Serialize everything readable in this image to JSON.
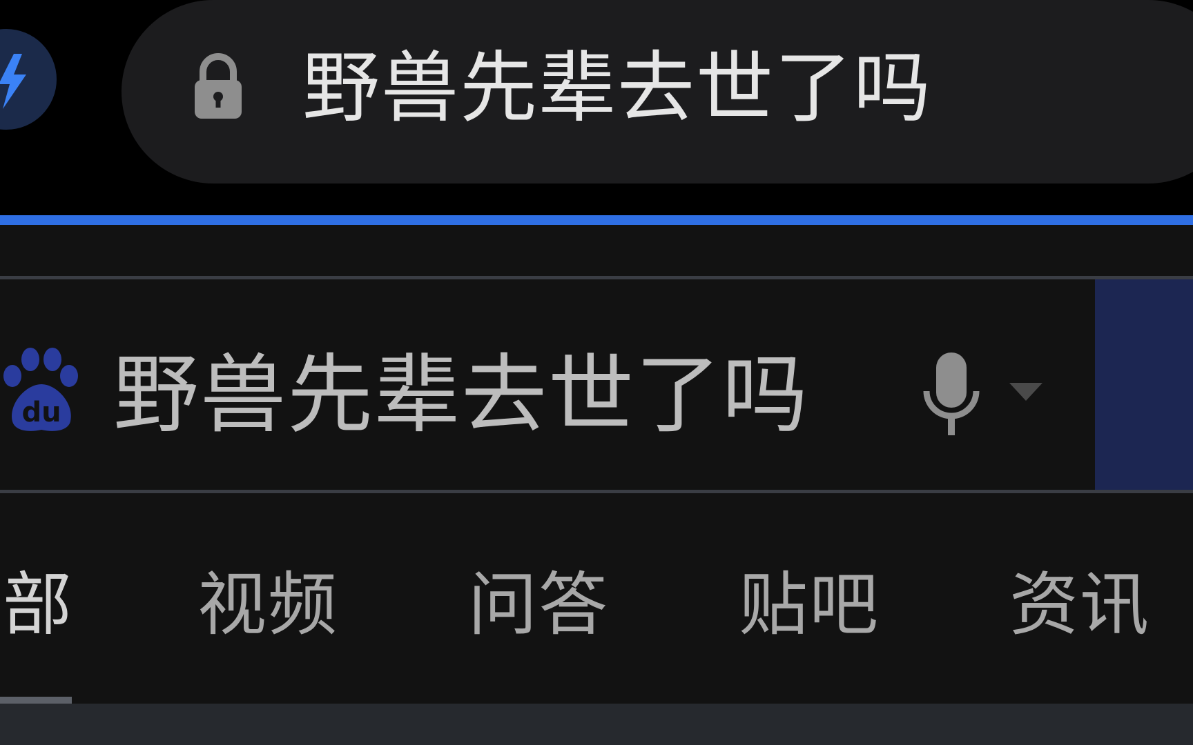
{
  "browser": {
    "url_text": "野兽先辈去世了吗"
  },
  "search": {
    "query": "野兽先辈去世了吗"
  },
  "tabs": [
    {
      "label": "部",
      "active": true
    },
    {
      "label": "视频",
      "active": false
    },
    {
      "label": "问答",
      "active": false
    },
    {
      "label": "贴吧",
      "active": false
    },
    {
      "label": "资讯",
      "active": false
    }
  ],
  "colors": {
    "accent": "#2f6fe4",
    "brand_baidu_blue": "#2a3c9e",
    "search_button": "#1c2652",
    "background": "#121212"
  },
  "icons": {
    "app_badge": "lightning-bolt-icon",
    "lock": "lock-icon",
    "search_logo": "baidu-paw-icon",
    "mic": "microphone-icon",
    "dropdown": "caret-down-icon"
  }
}
